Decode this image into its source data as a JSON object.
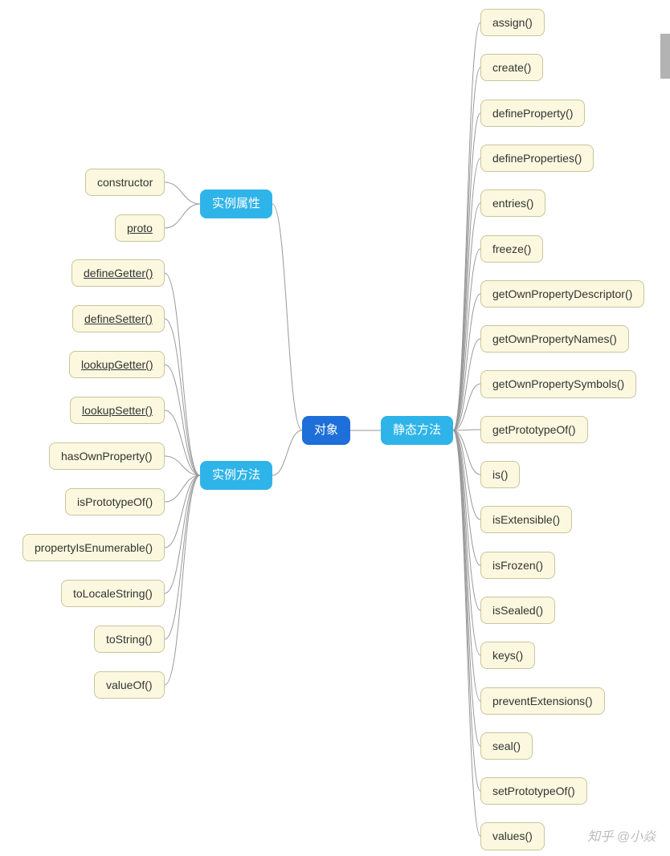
{
  "root": {
    "label": "对象"
  },
  "categories": {
    "instance_props": {
      "label": "实例属性"
    },
    "instance_methods": {
      "label": "实例方法"
    },
    "static_methods": {
      "label": "静态方法"
    }
  },
  "instance_props": [
    {
      "label": "constructor",
      "underline": false
    },
    {
      "label": "proto",
      "underline": true
    }
  ],
  "instance_methods": [
    {
      "label": "defineGetter()",
      "underline": true
    },
    {
      "label": "defineSetter()",
      "underline": true
    },
    {
      "label": "lookupGetter()",
      "underline": true
    },
    {
      "label": "lookupSetter()",
      "underline": true
    },
    {
      "label": "hasOwnProperty()",
      "underline": false
    },
    {
      "label": "isPrototypeOf()",
      "underline": false
    },
    {
      "label": "propertyIsEnumerable()",
      "underline": false
    },
    {
      "label": "toLocaleString()",
      "underline": false
    },
    {
      "label": "toString()",
      "underline": false
    },
    {
      "label": "valueOf()",
      "underline": false
    }
  ],
  "static_methods": [
    {
      "label": "assign()"
    },
    {
      "label": "create()"
    },
    {
      "label": "defineProperty()"
    },
    {
      "label": "defineProperties()"
    },
    {
      "label": "entries()"
    },
    {
      "label": "freeze()"
    },
    {
      "label": "getOwnPropertyDescriptor()"
    },
    {
      "label": "getOwnPropertyNames()"
    },
    {
      "label": "getOwnPropertySymbols()"
    },
    {
      "label": "getPrototypeOf()"
    },
    {
      "label": "is()"
    },
    {
      "label": "isExtensible()"
    },
    {
      "label": "isFrozen()"
    },
    {
      "label": "isSealed()"
    },
    {
      "label": "keys()"
    },
    {
      "label": "preventExtensions()"
    },
    {
      "label": "seal()"
    },
    {
      "label": "setPrototypeOf()"
    },
    {
      "label": "values()"
    }
  ],
  "watermark": "知乎 @小焱"
}
